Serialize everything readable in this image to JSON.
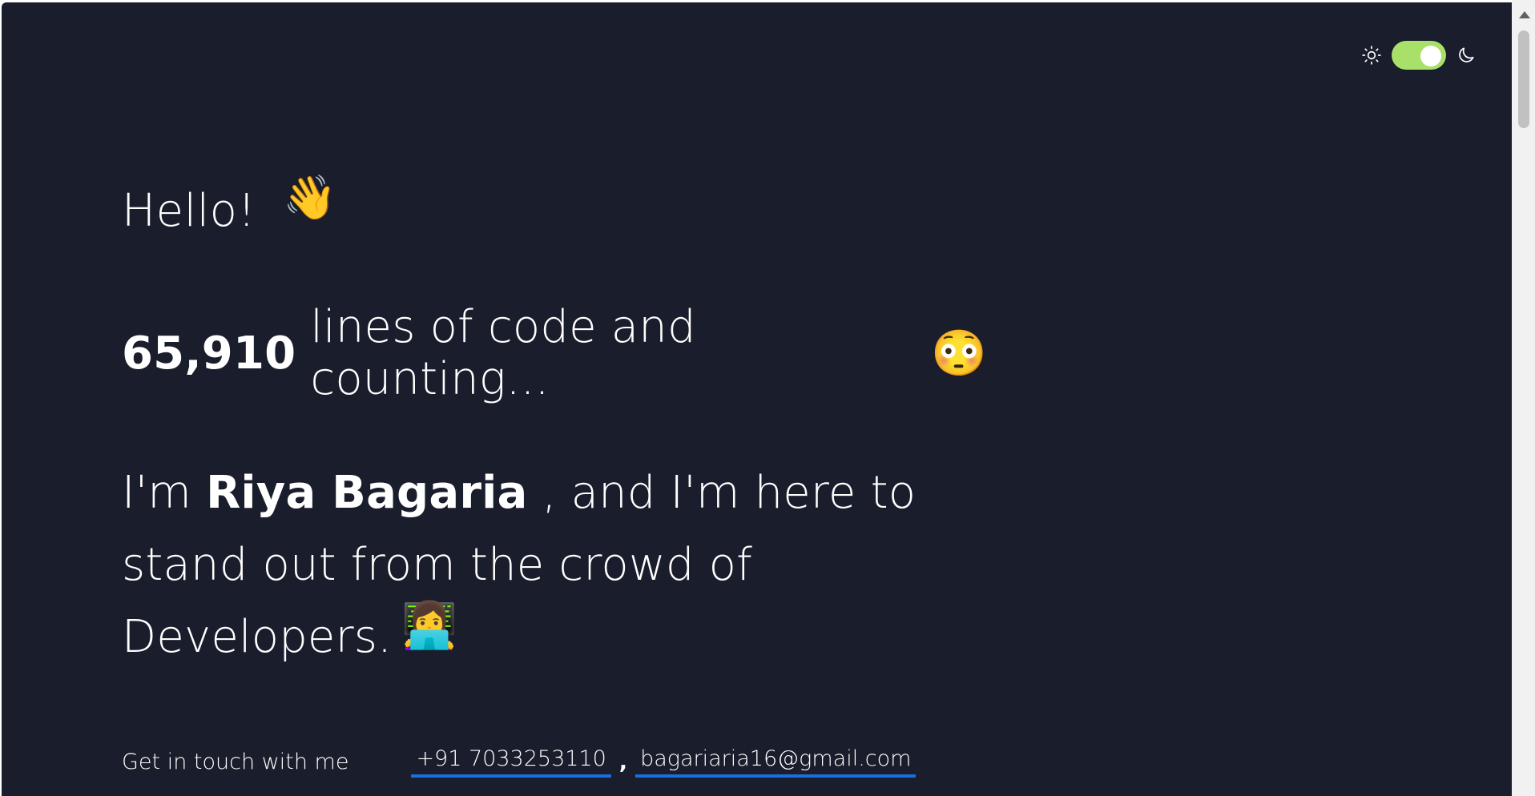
{
  "theme_toggle": {
    "light_icon": "sun-icon",
    "dark_icon": "moon-icon",
    "state": "on",
    "accent_color": "#a8e06a"
  },
  "hero": {
    "greeting": "Hello!",
    "greeting_emoji": "👋",
    "loc_count": "65,910",
    "loc_text": "lines of code and counting...",
    "loc_emoji": "😳",
    "intro_prefix": "I'm",
    "name": "Riya Bagaria",
    "intro_suffix": ", and I'm here to stand out from the crowd of Developers.",
    "intro_emoji": "👩‍💻"
  },
  "contact": {
    "label": "Get in touch with me",
    "phone": "+91 7033253110",
    "separator": ",",
    "email": "bagariaria16@gmail.com",
    "link_underline_color": "#1a6fe0"
  },
  "colors": {
    "background": "#1a1d2b",
    "text": "#ffffff"
  }
}
